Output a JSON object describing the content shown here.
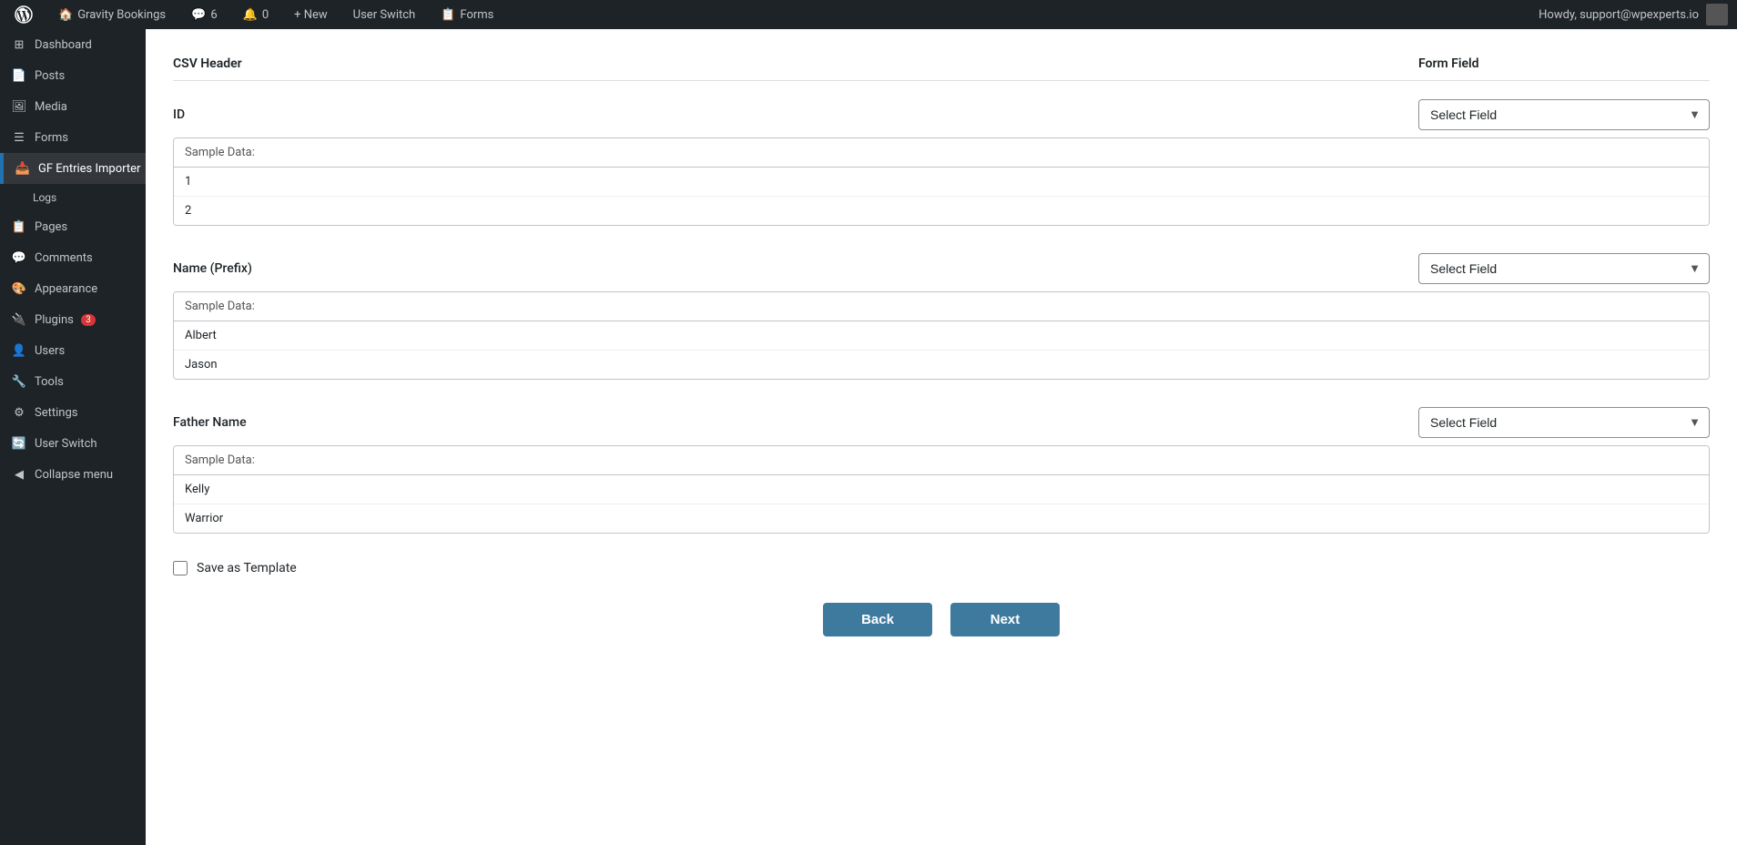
{
  "adminbar": {
    "wp_logo": "⊞",
    "site_name": "Gravity Bookings",
    "comments_icon": "💬",
    "comments_count": "6",
    "notif_count": "0",
    "new_label": "+ New",
    "user_switch_label": "User Switch",
    "forms_label": "Forms",
    "howdy_text": "Howdy, support@wpexperts.io"
  },
  "sidebar": {
    "items": [
      {
        "id": "dashboard",
        "label": "Dashboard",
        "icon": "⊞"
      },
      {
        "id": "posts",
        "label": "Posts",
        "icon": "📄"
      },
      {
        "id": "media",
        "label": "Media",
        "icon": "🖼"
      },
      {
        "id": "forms",
        "label": "Forms",
        "icon": "☰"
      },
      {
        "id": "gf-entries",
        "label": "GF Entries Importer",
        "icon": "📥",
        "active_parent": true
      },
      {
        "id": "logs",
        "label": "Logs",
        "sub": true
      },
      {
        "id": "pages",
        "label": "Pages",
        "icon": "📋"
      },
      {
        "id": "comments",
        "label": "Comments",
        "icon": "💬"
      },
      {
        "id": "appearance",
        "label": "Appearance",
        "icon": "🎨"
      },
      {
        "id": "plugins",
        "label": "Plugins",
        "icon": "🔌",
        "badge": "3"
      },
      {
        "id": "users",
        "label": "Users",
        "icon": "👤"
      },
      {
        "id": "tools",
        "label": "Tools",
        "icon": "🔧"
      },
      {
        "id": "settings",
        "label": "Settings",
        "icon": "⚙"
      },
      {
        "id": "user-switch",
        "label": "User Switch",
        "icon": "🔄"
      },
      {
        "id": "collapse",
        "label": "Collapse menu",
        "icon": "◀"
      }
    ]
  },
  "page": {
    "section_group_label": "GF Entries Importer",
    "column_csv": "CSV Header",
    "column_form": "Form Field",
    "fields": [
      {
        "id": "id-field",
        "label": "ID",
        "select_placeholder": "Select Field",
        "sample_data_label": "Sample Data:",
        "rows": [
          "1",
          "2"
        ]
      },
      {
        "id": "name-prefix-field",
        "label": "Name (Prefix)",
        "select_placeholder": "Select Field",
        "sample_data_label": "Sample Data:",
        "rows": [
          "Albert",
          "Jason"
        ]
      },
      {
        "id": "father-name-field",
        "label": "Father Name",
        "select_placeholder": "Select Field",
        "sample_data_label": "Sample Data:",
        "rows": [
          "Kelly",
          "Warrior"
        ]
      }
    ],
    "save_as_template_label": "Save as Template",
    "back_button": "Back",
    "next_button": "Next"
  }
}
